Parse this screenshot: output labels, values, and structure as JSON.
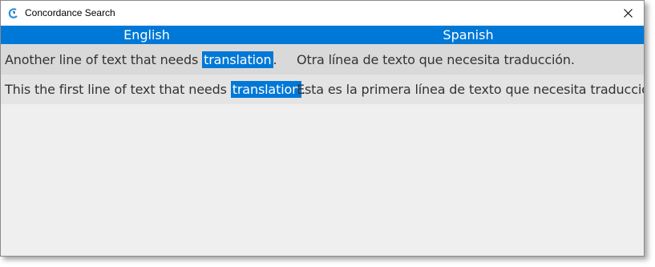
{
  "window": {
    "title": "Concordance Search"
  },
  "columns": {
    "source": "English",
    "target": "Spanish"
  },
  "rows": [
    {
      "source_before": "Another line of text that needs ",
      "source_match": "translation",
      "source_after": ".",
      "target": "Otra línea de texto que necesita traducción."
    },
    {
      "source_before": "This the first line of text that needs ",
      "source_match": "translation",
      "source_after": ".",
      "target": "Esta es la primera línea de texto que necesita traducción."
    }
  ],
  "colors": {
    "accent": "#0078d7",
    "row_odd": "#d9d9d9",
    "row_even": "#e4e4e4",
    "background": "#efefef"
  },
  "icons": {
    "app": "concordance-app-icon",
    "close": "close-icon"
  }
}
